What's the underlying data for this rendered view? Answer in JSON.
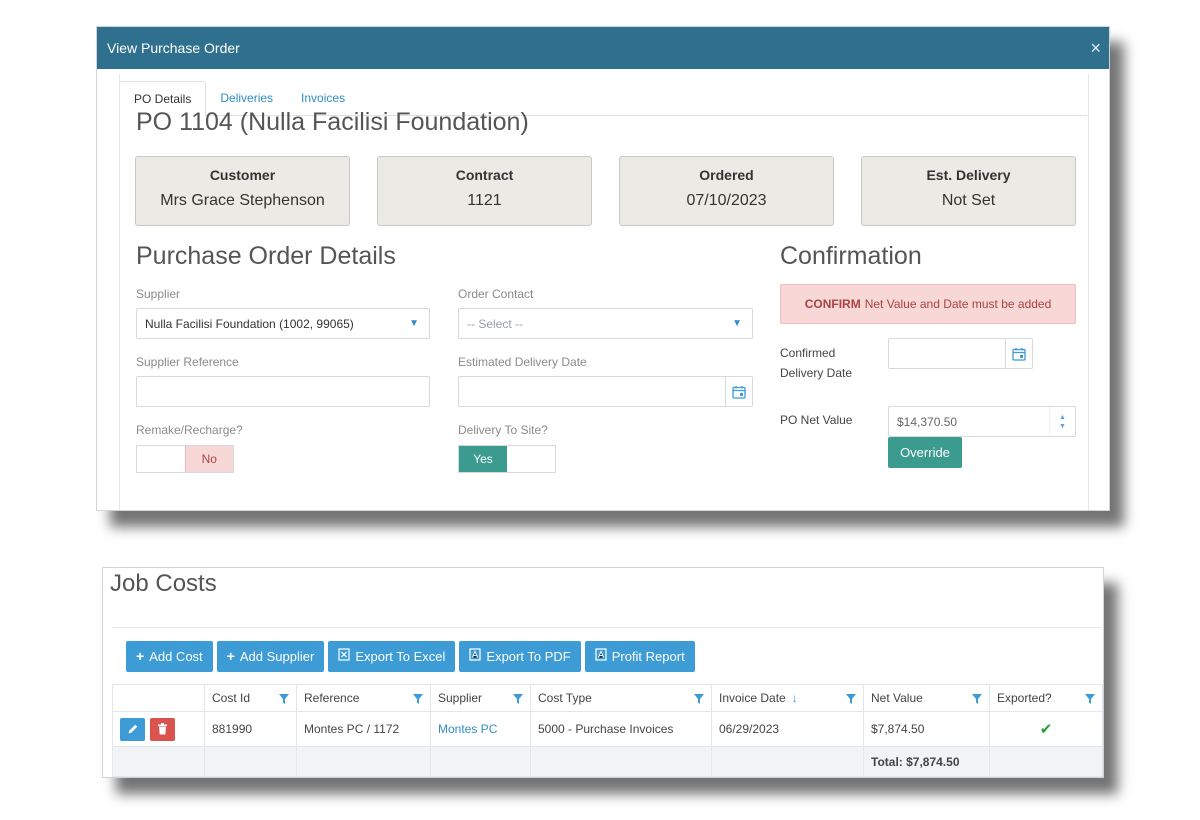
{
  "po_window": {
    "title": "View Purchase Order",
    "close_glyph": "×",
    "tabs": [
      {
        "label": "PO Details",
        "active": true
      },
      {
        "label": "Deliveries",
        "active": false
      },
      {
        "label": "Invoices",
        "active": false
      }
    ],
    "heading": "PO 1104 (Nulla Facilisi Foundation)",
    "summary": [
      {
        "label": "Customer",
        "value": "Mrs Grace Stephenson"
      },
      {
        "label": "Contract",
        "value": "1121"
      },
      {
        "label": "Ordered",
        "value": "07/10/2023"
      },
      {
        "label": "Est. Delivery",
        "value": "Not Set"
      }
    ],
    "details": {
      "heading": "Purchase Order Details",
      "supplier_label": "Supplier",
      "supplier_value": "Nulla Facilisi Foundation (1002, 99065)",
      "order_contact_label": "Order Contact",
      "order_contact_placeholder": "-- Select --",
      "supplier_reference_label": "Supplier Reference",
      "supplier_reference_value": "",
      "est_delivery_label": "Estimated Delivery Date",
      "est_delivery_value": "",
      "remake_label": "Remake/Recharge?",
      "remake_state": "No",
      "delivery_site_label": "Delivery To Site?",
      "delivery_site_state": "Yes"
    },
    "confirmation": {
      "heading": "Confirmation",
      "alert_strong": "CONFIRM",
      "alert_text": "Net Value and Date must be added",
      "confirmed_date_label": "Confirmed Delivery Date",
      "confirmed_date_value": "",
      "net_value_label": "PO Net Value",
      "net_value": "$14,370.50",
      "override_label": "Override"
    },
    "colors": {
      "titlebar": "#30708f",
      "teal": "#3a9b8e",
      "alert_bg": "#f8d7d7"
    }
  },
  "job_costs": {
    "title": "Job Costs",
    "toolbar": [
      {
        "icon": "plus-icon",
        "label": "Add Cost"
      },
      {
        "icon": "plus-icon",
        "label": "Add Supplier"
      },
      {
        "icon": "excel-icon",
        "label": "Export To Excel"
      },
      {
        "icon": "pdf-icon",
        "label": "Export To PDF"
      },
      {
        "icon": "pdf-icon",
        "label": "Profit Report"
      }
    ],
    "columns": [
      "Cost Id",
      "Reference",
      "Supplier",
      "Cost Type",
      "Invoice Date",
      "Net Value",
      "Exported?"
    ],
    "rows": [
      {
        "cost_id": "881990",
        "reference": "Montes PC / 1172",
        "supplier": "Montes PC",
        "cost_type": "5000 - Purchase Invoices",
        "invoice_date": "06/29/2023",
        "net_value": "$7,874.50",
        "exported": true
      }
    ],
    "total": "Total: $7,874.50",
    "colors": {
      "button": "#3d9bd6",
      "delete": "#d9534f",
      "check": "#2e9a3a"
    }
  }
}
